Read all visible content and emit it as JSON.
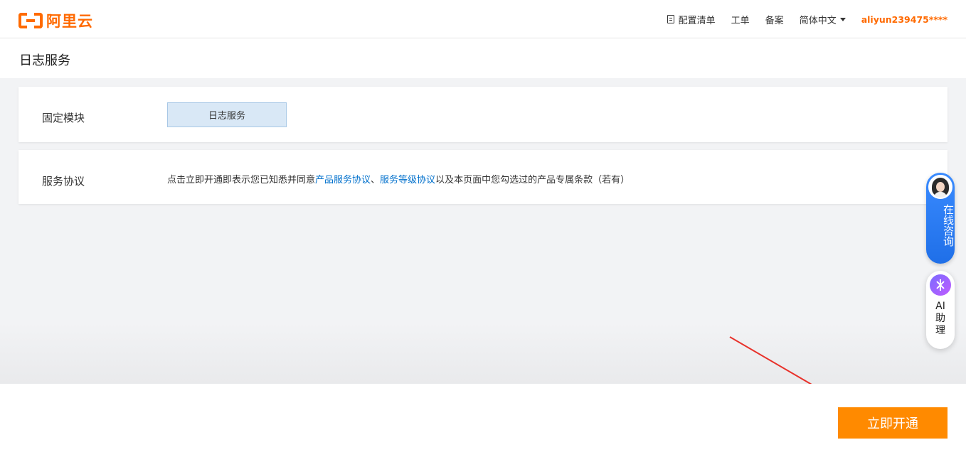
{
  "header": {
    "logo_text": "阿里云",
    "nav": {
      "config_list": "配置清单",
      "ticket": "工单",
      "filing": "备案",
      "language": "简体中文",
      "user": "aliyun239475****"
    }
  },
  "page": {
    "title": "日志服务"
  },
  "module": {
    "label": "固定模块",
    "tag": "日志服务"
  },
  "agreement": {
    "label": "服务协议",
    "prefix": "点击立即开通即表示您已知悉并同意",
    "link1": "产品服务协议",
    "sep": "、",
    "link2": "服务等级协议",
    "suffix": "以及本页面中您勾选过的产品专属条款（若有）"
  },
  "float": {
    "consult": "在线咨询",
    "ai_line1": "AI",
    "ai_line2": "助",
    "ai_line3": "理"
  },
  "footer": {
    "open_button": "立即开通"
  },
  "colors": {
    "brand": "#ff6a00",
    "button": "#ff8a00",
    "link": "#0070cc",
    "annotation_arrow": "#e8322b"
  }
}
